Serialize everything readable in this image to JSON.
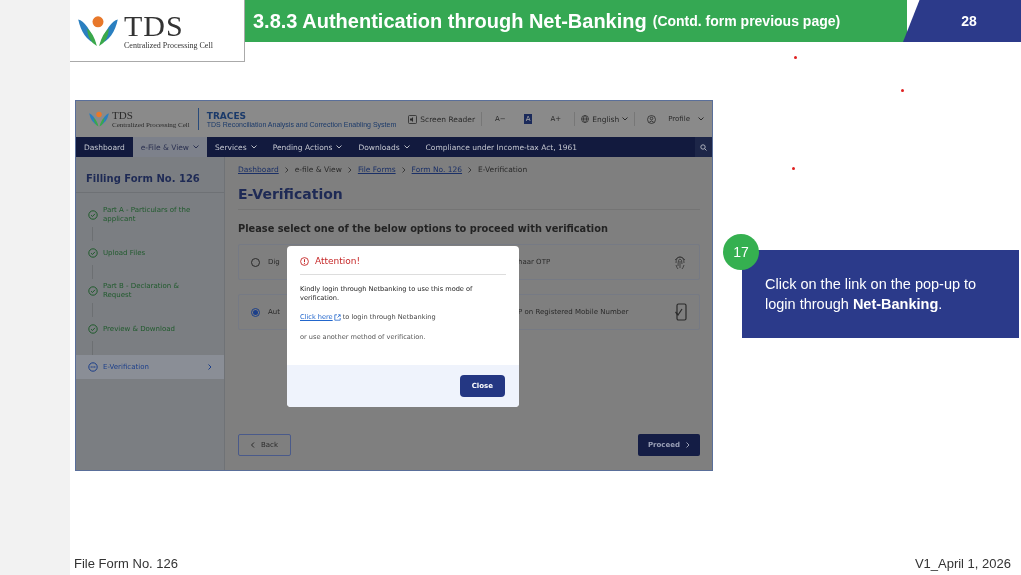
{
  "slide_header": {
    "logo_text": "TDS",
    "logo_subtitle": "Centralized Processing Cell",
    "title": "3.8.3 Authentication through Net-Banking",
    "title_note": "(Contd. form previous page)",
    "page_number": "28"
  },
  "app": {
    "header": {
      "logo_text": "TDS",
      "logo_subtitle": "Centralized Processing Cell",
      "brand": "TRACES",
      "brand_subtitle": "TDS Reconciliation Analysis and Correction Enabling System",
      "screen_reader": "Screen Reader",
      "font_buttons": [
        {
          "label": "A−",
          "selected": false
        },
        {
          "label": "A",
          "selected": true
        },
        {
          "label": "A+",
          "selected": false
        }
      ],
      "language": "English",
      "profile": "Profile"
    },
    "nav": [
      {
        "label": "Dashboard",
        "selected": false,
        "dropdown": false
      },
      {
        "label": "e-File & View",
        "selected": true,
        "dropdown": true
      },
      {
        "label": "Services",
        "selected": false,
        "dropdown": true
      },
      {
        "label": "Pending Actions",
        "selected": false,
        "dropdown": true
      },
      {
        "label": "Downloads",
        "selected": false,
        "dropdown": true
      },
      {
        "label": "Compliance under Income-tax Act, 1961",
        "selected": false,
        "dropdown": false
      }
    ],
    "sidebar": {
      "title": "Filling Form No. 126",
      "steps": [
        {
          "label": "Part A - Particulars of the applicant",
          "kind": "done",
          "selected": false
        },
        {
          "label": "Upload Files",
          "kind": "done",
          "selected": false
        },
        {
          "label": "Part B - Declaration & Request",
          "kind": "done",
          "selected": false
        },
        {
          "label": "Preview & Download",
          "kind": "done",
          "selected": false
        },
        {
          "label": "E-Verification",
          "kind": "current",
          "selected": true
        }
      ]
    },
    "breadcrumb": [
      {
        "label": "Dashboard",
        "link": true
      },
      {
        "label": "e-file & View",
        "link": false
      },
      {
        "label": "File Forms",
        "link": true
      },
      {
        "label": "Form No. 126",
        "link": true
      },
      {
        "label": "E-Verification",
        "link": false
      }
    ],
    "page_title": "E-Verification",
    "prompt": "Please select one of the below options to proceed with verification",
    "options": [
      {
        "label_start": "Dig",
        "label_end": "haar OTP",
        "kind": "fingerprint",
        "selected": false
      },
      {
        "label_start": "Aut",
        "label_end": "P on Registered Mobile Number",
        "kind": "phone",
        "selected": true
      }
    ],
    "back_button": "Back",
    "proceed_button": "Proceed",
    "modal": {
      "title": "Attention!",
      "message": "Kindly login through Netbanking to use this mode of verification.",
      "link": "Click here",
      "link_rest": "to login through Netbanking",
      "alt_text": "or use another method of verification.",
      "close_button": "Close"
    }
  },
  "callout": {
    "step": "17",
    "text": "Click on the link on the pop-up to login through **Net-Banking**."
  },
  "footer": {
    "left": "File Form No. 126",
    "right": "V1_April 1, 2026"
  }
}
